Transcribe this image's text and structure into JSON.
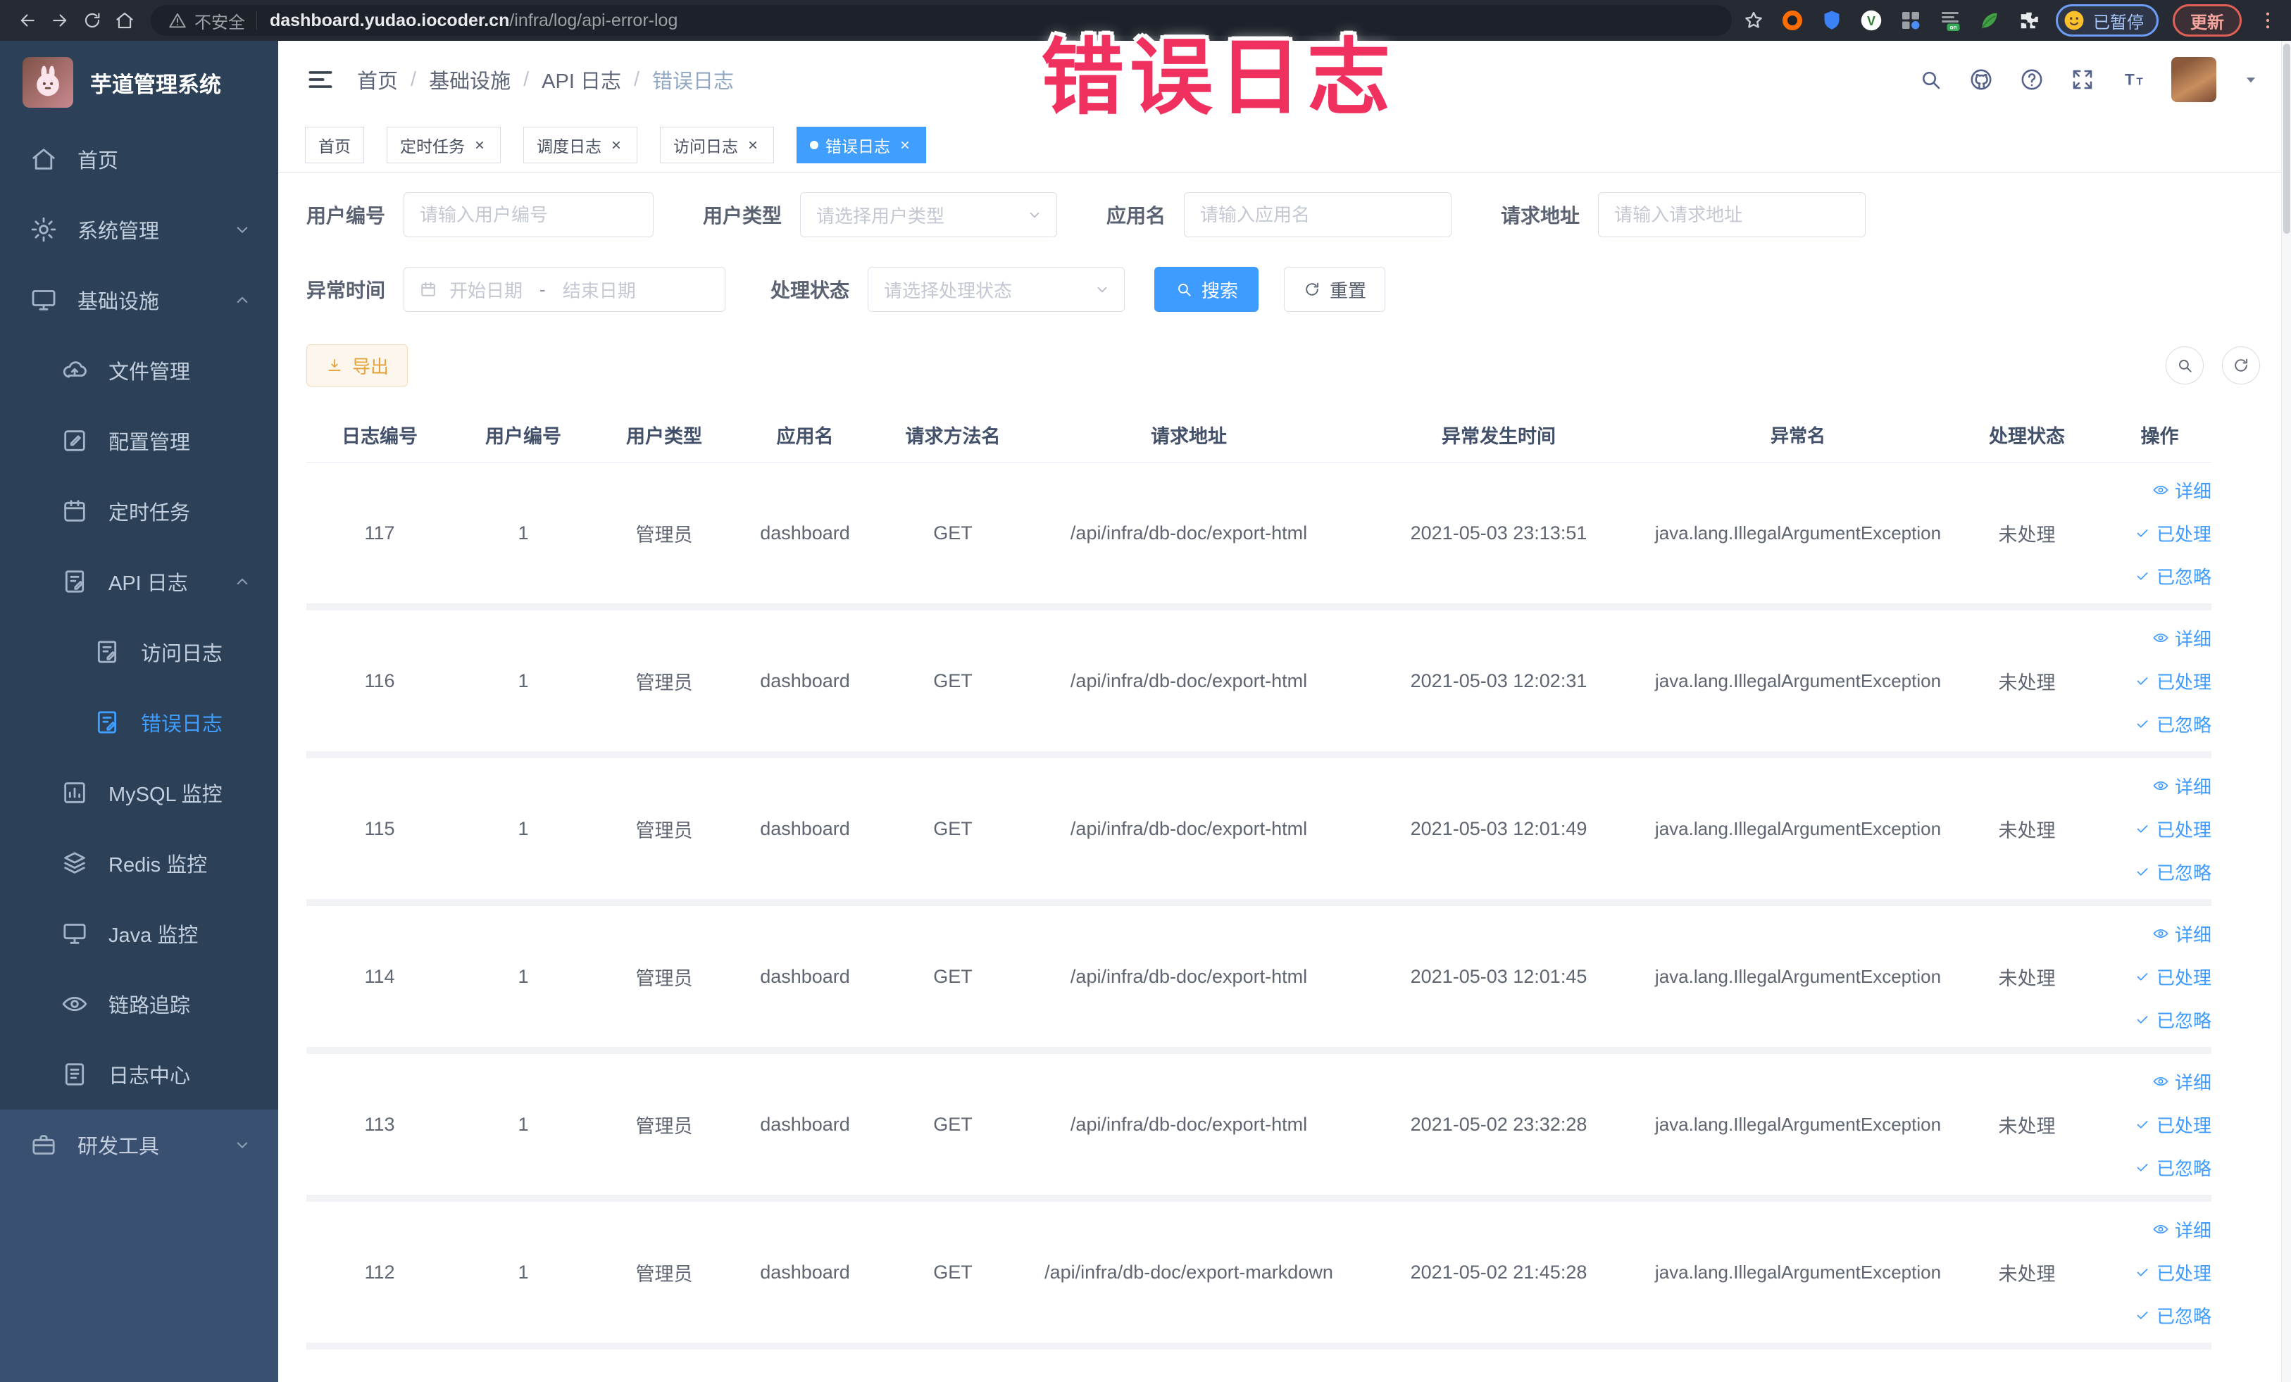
{
  "watermark_text": "错误日志",
  "browser": {
    "security_label": "不安全",
    "url_domain": "dashboard.yudao.iocoder.cn",
    "url_path": "/infra/log/api-error-log",
    "profile_status": "已暂停",
    "update_label": "更新"
  },
  "sidebar": {
    "app_title": "芋道管理系统",
    "items": [
      {
        "label": "首页",
        "icon": "home-icon",
        "state": [
          "depth-1"
        ]
      },
      {
        "label": "系统管理",
        "icon": "gear-icon",
        "arrow": "chevron-down-icon",
        "state": [
          "depth-1"
        ]
      },
      {
        "label": "基础设施",
        "icon": "infrastructure-icon",
        "arrow": "chevron-up-icon",
        "state": [
          "depth-1"
        ]
      },
      {
        "label": "文件管理",
        "icon": "cloud-upload-icon",
        "state": [
          "depth-2"
        ]
      },
      {
        "label": "配置管理",
        "icon": "config-edit-icon",
        "state": [
          "depth-2"
        ]
      },
      {
        "label": "定时任务",
        "icon": "schedule-icon",
        "state": [
          "depth-2"
        ]
      },
      {
        "label": "API 日志",
        "icon": "api-log-icon",
        "arrow": "chevron-up-icon",
        "state": [
          "depth-2"
        ]
      },
      {
        "label": "访问日志",
        "icon": "access-log-icon",
        "state": [
          "depth-3"
        ]
      },
      {
        "label": "错误日志",
        "icon": "error-log-icon",
        "state": [
          "depth-3",
          "active"
        ]
      },
      {
        "label": "MySQL 监控",
        "icon": "mysql-monitor-icon",
        "state": [
          "depth-2"
        ]
      },
      {
        "label": "Redis 监控",
        "icon": "redis-monitor-icon",
        "state": [
          "depth-2"
        ]
      },
      {
        "label": "Java 监控",
        "icon": "java-monitor-icon",
        "state": [
          "depth-2"
        ]
      },
      {
        "label": "链路追踪",
        "icon": "trace-icon",
        "state": [
          "depth-2"
        ]
      },
      {
        "label": "日志中心",
        "icon": "log-center-icon",
        "state": [
          "depth-2"
        ]
      },
      {
        "label": "研发工具",
        "icon": "devtools-icon",
        "arrow": "chevron-down-icon",
        "state": [
          "depth-1",
          "light-section"
        ]
      }
    ]
  },
  "header": {
    "separator": "/",
    "breadcrumb": [
      {
        "label": "首页",
        "state": []
      },
      {
        "label": "基础设施",
        "state": []
      },
      {
        "label": "API 日志",
        "state": []
      },
      {
        "label": "错误日志",
        "state": [
          "current"
        ]
      }
    ]
  },
  "tabs": [
    {
      "label": "首页",
      "state": []
    },
    {
      "label": "定时任务",
      "state": [
        "closable"
      ]
    },
    {
      "label": "调度日志",
      "state": [
        "closable"
      ]
    },
    {
      "label": "访问日志",
      "state": [
        "closable"
      ]
    },
    {
      "label": "错误日志",
      "state": [
        "closable",
        "active"
      ]
    }
  ],
  "filters": {
    "fields": [
      {
        "label": "用户编号",
        "placeholder": "请输入用户编号",
        "state": [
          "input",
          "w-355"
        ]
      },
      {
        "label": "用户类型",
        "placeholder": "请选择用户类型",
        "state": [
          "select",
          "w-365"
        ]
      },
      {
        "label": "应用名",
        "placeholder": "请输入应用名",
        "state": [
          "input",
          "w-380"
        ]
      },
      {
        "label": "请求地址",
        "placeholder": "请输入请求地址",
        "state": [
          "input",
          "w-380"
        ]
      }
    ],
    "time_label": "异常时间",
    "date_start_placeholder": "开始日期",
    "date_separator": "-",
    "date_end_placeholder": "结束日期",
    "status_label": "处理状态",
    "status_placeholder": "请选择处理状态",
    "search_label": "搜索",
    "reset_label": "重置"
  },
  "toolbar": {
    "export_label": "导出"
  },
  "table": {
    "columns": [
      {
        "label": "日志编号",
        "state": [
          "col-0"
        ]
      },
      {
        "label": "用户编号",
        "state": [
          "col-1"
        ]
      },
      {
        "label": "用户类型",
        "state": [
          "col-2"
        ]
      },
      {
        "label": "应用名",
        "state": [
          "col-3"
        ]
      },
      {
        "label": "请求方法名",
        "state": [
          "col-4"
        ]
      },
      {
        "label": "请求地址",
        "state": [
          "col-5"
        ]
      },
      {
        "label": "异常发生时间",
        "state": [
          "col-6"
        ]
      },
      {
        "label": "异常名",
        "state": [
          "col-7"
        ]
      },
      {
        "label": "处理状态",
        "state": [
          "col-8"
        ]
      },
      {
        "label": "操作",
        "state": [
          "col-9"
        ]
      }
    ],
    "action_labels": {
      "detail": "详细",
      "processed": "已处理",
      "ignored": "已忽略"
    },
    "rows": [
      {
        "id": "117",
        "user_id": "1",
        "user_type": "管理员",
        "app_name": "dashboard",
        "method": "GET",
        "url": "/api/infra/db-doc/export-html",
        "time": "2021-05-03 23:13:51",
        "exception": "java.lang.IllegalArgumentException",
        "status": "未处理"
      },
      {
        "id": "116",
        "user_id": "1",
        "user_type": "管理员",
        "app_name": "dashboard",
        "method": "GET",
        "url": "/api/infra/db-doc/export-html",
        "time": "2021-05-03 12:02:31",
        "exception": "java.lang.IllegalArgumentException",
        "status": "未处理"
      },
      {
        "id": "115",
        "user_id": "1",
        "user_type": "管理员",
        "app_name": "dashboard",
        "method": "GET",
        "url": "/api/infra/db-doc/export-html",
        "time": "2021-05-03 12:01:49",
        "exception": "java.lang.IllegalArgumentException",
        "status": "未处理"
      },
      {
        "id": "114",
        "user_id": "1",
        "user_type": "管理员",
        "app_name": "dashboard",
        "method": "GET",
        "url": "/api/infra/db-doc/export-html",
        "time": "2021-05-03 12:01:45",
        "exception": "java.lang.IllegalArgumentException",
        "status": "未处理"
      },
      {
        "id": "113",
        "user_id": "1",
        "user_type": "管理员",
        "app_name": "dashboard",
        "method": "GET",
        "url": "/api/infra/db-doc/export-html",
        "time": "2021-05-02 23:32:28",
        "exception": "java.lang.IllegalArgumentException",
        "status": "未处理"
      },
      {
        "id": "112",
        "user_id": "1",
        "user_type": "管理员",
        "app_name": "dashboard",
        "method": "GET",
        "url": "/api/infra/db-doc/export-markdown",
        "time": "2021-05-02 21:45:28",
        "exception": "java.lang.IllegalArgumentException",
        "status": "未处理"
      }
    ]
  }
}
